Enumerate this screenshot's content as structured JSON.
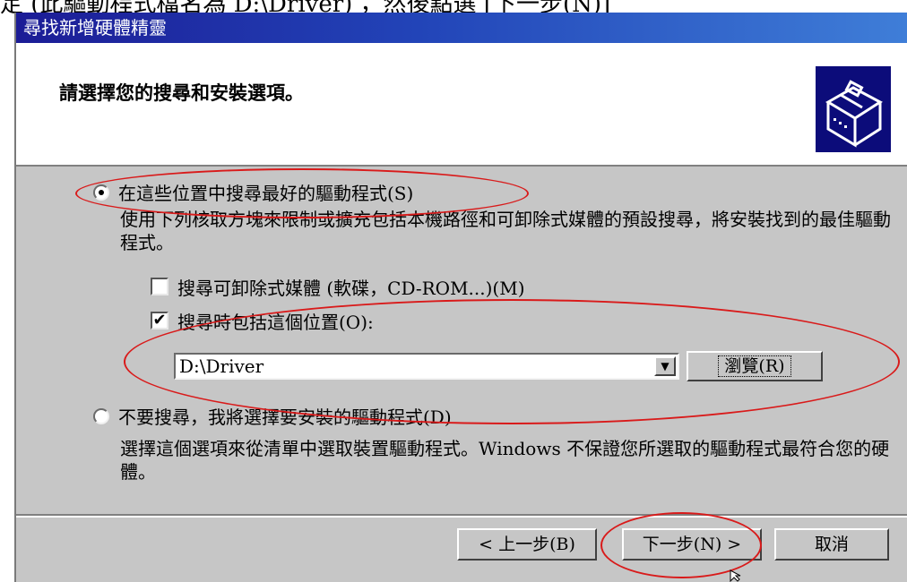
{
  "caption": "定 (此驅動程式檔名為 D:\\Driver) ，然後點選 [下一步(N)]",
  "window": {
    "title": "尋找新增硬體精靈"
  },
  "header": {
    "title": "請選擇您的搜尋和安裝選項。",
    "icon": "wizard-hardware-icon"
  },
  "option_search": {
    "label": "在這些位置中搜尋最好的驅動程式(S)",
    "selected": true,
    "description": "使用下列核取方塊來限制或擴充包括本機路徑和可卸除式媒體的預設搜尋，將安裝找到的最佳驅動程式。"
  },
  "checkbox_removable": {
    "label": "搜尋可卸除式媒體 (軟碟，CD-ROM...)(M)",
    "checked": false
  },
  "checkbox_location": {
    "label": "搜尋時包括這個位置(O):",
    "checked": true
  },
  "location_combo": {
    "value": "D:\\Driver"
  },
  "browse_button": {
    "label": "瀏覽(R)"
  },
  "option_manual": {
    "label": "不要搜尋，我將選擇要安裝的驅動程式(D)",
    "selected": false,
    "description": "選擇這個選項來從清單中選取裝置驅動程式。Windows 不保證您所選取的驅動程式最符合您的硬體。"
  },
  "footer": {
    "back_label": "< 上一步(B)",
    "next_label": "下一步(N) >",
    "cancel_label": "取消"
  },
  "annotation_color": "#d91a1a"
}
